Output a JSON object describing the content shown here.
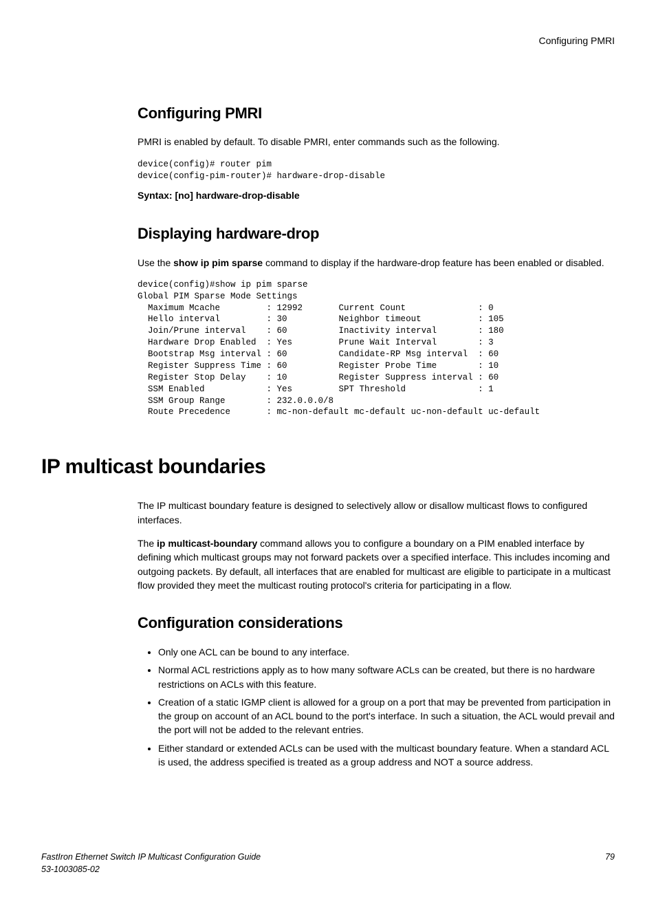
{
  "header": {
    "right_label": "Configuring PMRI"
  },
  "section1": {
    "heading": "Configuring PMRI",
    "para": "PMRI is enabled by default. To disable PMRI, enter commands such as the following.",
    "code": "device(config)# router pim\ndevice(config-pim-router)# hardware-drop-disable",
    "syntax": "Syntax: [no] hardware-drop-disable"
  },
  "section2": {
    "heading": "Displaying hardware-drop",
    "para_pre": "Use the ",
    "para_bold": "show ip pim sparse",
    "para_post": " command to display if the hardware-drop feature has been enabled or disabled.",
    "code": "device(config)#show ip pim sparse\nGlobal PIM Sparse Mode Settings\n  Maximum Mcache         : 12992       Current Count              : 0\n  Hello interval         : 30          Neighbor timeout           : 105\n  Join/Prune interval    : 60          Inactivity interval        : 180\n  Hardware Drop Enabled  : Yes         Prune Wait Interval        : 3\n  Bootstrap Msg interval : 60          Candidate-RP Msg interval  : 60\n  Register Suppress Time : 60          Register Probe Time        : 10\n  Register Stop Delay    : 10          Register Suppress interval : 60\n  SSM Enabled            : Yes         SPT Threshold              : 1\n  SSM Group Range        : 232.0.0.0/8\n  Route Precedence       : mc-non-default mc-default uc-non-default uc-default"
  },
  "section3": {
    "heading": "IP multicast boundaries",
    "para1": "The IP multicast boundary feature is designed to selectively allow or disallow multicast flows to configured interfaces.",
    "para2_pre": "The ",
    "para2_bold": "ip multicast-boundary",
    "para2_post": " command allows you to configure a boundary on a PIM enabled interface by defining which multicast groups may not forward packets over a specified interface. This includes incoming and outgoing packets. By default, all interfaces that are enabled for multicast are eligible to participate in a multicast flow provided they meet the multicast routing protocol's criteria for participating in a flow."
  },
  "section4": {
    "heading": "Configuration considerations",
    "items": [
      "Only one ACL can be bound to any interface.",
      "Normal ACL restrictions apply as to how many software ACLs can be created, but there is no hardware restrictions on ACLs with this feature.",
      "Creation of a static IGMP client is allowed for a group on a port that may be prevented from participation in the group on account of an ACL bound to the port's interface. In such a situation, the ACL would prevail and the port will not be added to the relevant entries.",
      "Either standard or extended ACLs can be used with the multicast boundary feature. When a standard ACL is used, the address specified is treated as a group address and NOT a source address."
    ]
  },
  "footer": {
    "book_title": "FastIron Ethernet Switch IP Multicast Configuration Guide",
    "doc_number": "53-1003085-02",
    "page_number": "79"
  }
}
